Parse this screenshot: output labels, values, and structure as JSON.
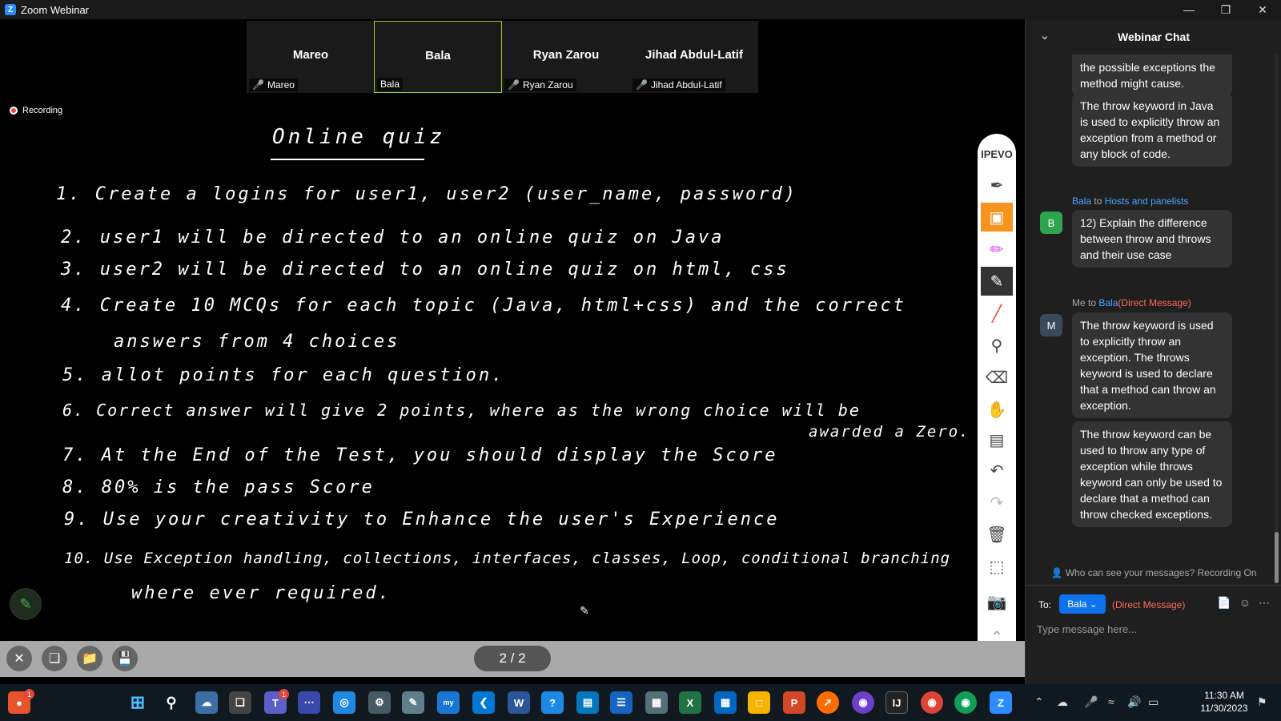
{
  "window": {
    "title": "Zoom Webinar"
  },
  "participants": [
    {
      "name": "Mareo",
      "tag": "Mareo",
      "muted": true,
      "active": false
    },
    {
      "name": "Bala",
      "tag": "Bala",
      "muted": false,
      "active": true
    },
    {
      "name": "Ryan Zarou",
      "tag": "Ryan Zarou",
      "muted": true,
      "active": false
    },
    {
      "name": "Jihad Abdul-Latif",
      "tag": "Jihad Abdul-Latif",
      "muted": true,
      "active": false
    }
  ],
  "board": {
    "recording_label": "Recording",
    "title": "Online quiz",
    "lines": [
      "1. Create a logins for user1, user2 (user_name, password)",
      "2. user1 will be directed to an online quiz on Java",
      "3. user2 will be directed to an online quiz on html, css",
      "4. Create 10 MCQs for each topic (Java, html+css) and the correct",
      "answers from 4 choices",
      "5. allot points for each question.",
      "6. Correct answer will give 2 points, where as the wrong choice will be",
      "awarded a Zero.",
      "7. At the End of the Test, you should display the Score",
      "8. 80% is the pass Score",
      "9. Use your creativity to Enhance the user's Experience",
      "10. Use Exception handling, collections, interfaces, classes, Loop, conditional branching",
      "where ever required."
    ],
    "pager": "2 / 2"
  },
  "ipevo": {
    "brand": "IPEVO"
  },
  "chat": {
    "title": "Webinar Chat",
    "messages": [
      {
        "text": "the possible exceptions the method might cause."
      },
      {
        "text": "The throw keyword in Java is used to explicitly throw an exception from a method or any block of code."
      },
      {
        "from": "Bala",
        "to_word": "to",
        "to": "Hosts and panelists",
        "avatar": "B",
        "text": "12)      Explain the difference between throw and throws and their use case"
      },
      {
        "from": "Me",
        "to_word": "to",
        "to": "Bala",
        "dm": "(Direct Message)",
        "avatar": "M",
        "text": "The throw keyword is used to explicitly throw an exception. The throws keyword is used to declare that a method can throw an exception."
      },
      {
        "text": "The throw keyword can be used to throw any type of exception while throws keyword can only be used to declare that a method can throw checked exceptions."
      }
    ],
    "who_can_see": "Who can see your messages? Recording On",
    "to_label": "To:",
    "to_value": "Bala",
    "dm_label": "(Direct Message)",
    "input_placeholder": "Type message here..."
  },
  "taskbar": {
    "time": "11:30 AM",
    "date": "11/30/2023",
    "badges": {
      "first": "1",
      "teams": "1"
    }
  },
  "colors": {
    "zoom_blue": "#0e72ed",
    "ipevo_orange": "#f7931e",
    "rec_red": "#e0463c"
  }
}
